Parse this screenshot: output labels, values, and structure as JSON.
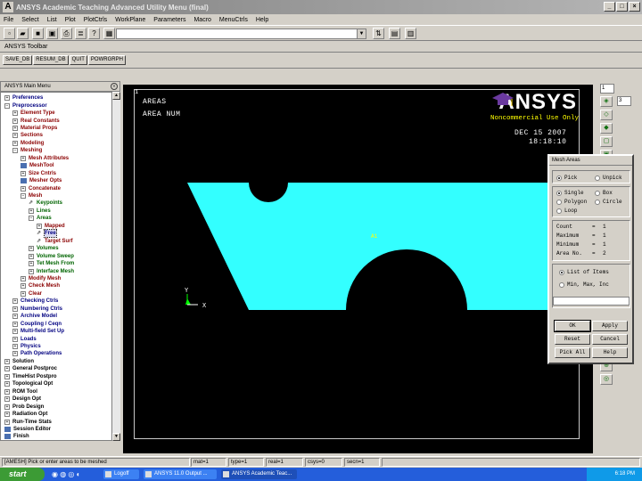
{
  "window": {
    "title": "ANSYS Academic Teaching Advanced Utility Menu (final)",
    "controls": [
      "_",
      "□",
      "×"
    ]
  },
  "menubar": [
    "File",
    "Select",
    "List",
    "Plot",
    "PlotCtrls",
    "WorkPlane",
    "Parameters",
    "Macro",
    "MenuCtrls",
    "Help"
  ],
  "toolbar": {
    "title": "ANSYS Toolbar",
    "buttons": [
      "SAVE_DB",
      "RESUM_DB",
      "QUIT",
      "POWRGRPH"
    ],
    "command_value": ""
  },
  "main_menu": {
    "title": "ANSYS Main Menu",
    "items": [
      {
        "label": "Preferences",
        "level": 0,
        "kind": "box",
        "color": "#000080"
      },
      {
        "label": "Preprocessor",
        "level": 0,
        "kind": "minus",
        "color": "#000080"
      },
      {
        "label": "Element Type",
        "level": 1,
        "kind": "box",
        "color": "#8b0000"
      },
      {
        "label": "Real Constants",
        "level": 1,
        "kind": "box",
        "color": "#8b0000"
      },
      {
        "label": "Material Props",
        "level": 1,
        "kind": "box",
        "color": "#8b0000"
      },
      {
        "label": "Sections",
        "level": 1,
        "kind": "box",
        "color": "#8b0000"
      },
      {
        "label": "Modeling",
        "level": 1,
        "kind": "box",
        "color": "#8b0000"
      },
      {
        "label": "Meshing",
        "level": 1,
        "kind": "minus",
        "color": "#8b0000"
      },
      {
        "label": "Mesh Attributes",
        "level": 2,
        "kind": "box",
        "color": "#8b0000"
      },
      {
        "label": "MeshTool",
        "level": 2,
        "kind": "icon",
        "color": "#8b0000"
      },
      {
        "label": "Size Cntrls",
        "level": 2,
        "kind": "box",
        "color": "#8b0000"
      },
      {
        "label": "Mesher Opts",
        "level": 2,
        "kind": "icon",
        "color": "#8b0000"
      },
      {
        "label": "Concatenate",
        "level": 2,
        "kind": "box",
        "color": "#8b0000"
      },
      {
        "label": "Mesh",
        "level": 2,
        "kind": "minus",
        "color": "#8b0000"
      },
      {
        "label": "Keypoints",
        "level": 3,
        "kind": "pin",
        "color": "#006400"
      },
      {
        "label": "Lines",
        "level": 3,
        "kind": "box",
        "color": "#006400"
      },
      {
        "label": "Areas",
        "level": 3,
        "kind": "minus",
        "color": "#006400"
      },
      {
        "label": "Mapped",
        "level": 4,
        "kind": "box",
        "color": "#8b0000"
      },
      {
        "label": "Free",
        "level": 4,
        "kind": "pin",
        "color": "#000080",
        "selected": true
      },
      {
        "label": "Target Surf",
        "level": 4,
        "kind": "pin",
        "color": "#8b0000"
      },
      {
        "label": "Volumes",
        "level": 3,
        "kind": "box",
        "color": "#006400"
      },
      {
        "label": "Volume Sweep",
        "level": 3,
        "kind": "box",
        "color": "#006400"
      },
      {
        "label": "Tet Mesh From",
        "level": 3,
        "kind": "box",
        "color": "#006400"
      },
      {
        "label": "Interface Mesh",
        "level": 3,
        "kind": "box",
        "color": "#006400"
      },
      {
        "label": "Modify Mesh",
        "level": 2,
        "kind": "box",
        "color": "#8b0000"
      },
      {
        "label": "Check Mesh",
        "level": 2,
        "kind": "box",
        "color": "#8b0000"
      },
      {
        "label": "Clear",
        "level": 2,
        "kind": "box",
        "color": "#8b0000"
      },
      {
        "label": "Checking Ctrls",
        "level": 1,
        "kind": "box",
        "color": "#000080"
      },
      {
        "label": "Numbering Ctrls",
        "level": 1,
        "kind": "box",
        "color": "#000080"
      },
      {
        "label": "Archive Model",
        "level": 1,
        "kind": "box",
        "color": "#000080"
      },
      {
        "label": "Coupling / Ceqn",
        "level": 1,
        "kind": "box",
        "color": "#000080"
      },
      {
        "label": "Multi-field Set Up",
        "level": 1,
        "kind": "box",
        "color": "#000080"
      },
      {
        "label": "Loads",
        "level": 1,
        "kind": "box",
        "color": "#000080"
      },
      {
        "label": "Physics",
        "level": 1,
        "kind": "box",
        "color": "#000080"
      },
      {
        "label": "Path Operations",
        "level": 1,
        "kind": "box",
        "color": "#000080"
      },
      {
        "label": "Solution",
        "level": 0,
        "kind": "box",
        "color": "#000"
      },
      {
        "label": "General Postproc",
        "level": 0,
        "kind": "box",
        "color": "#000"
      },
      {
        "label": "TimeHist Postpro",
        "level": 0,
        "kind": "box",
        "color": "#000"
      },
      {
        "label": "Topological Opt",
        "level": 0,
        "kind": "box",
        "color": "#000"
      },
      {
        "label": "ROM Tool",
        "level": 0,
        "kind": "box",
        "color": "#000"
      },
      {
        "label": "Design Opt",
        "level": 0,
        "kind": "box",
        "color": "#000"
      },
      {
        "label": "Prob Design",
        "level": 0,
        "kind": "box",
        "color": "#000"
      },
      {
        "label": "Radiation Opt",
        "level": 0,
        "kind": "box",
        "color": "#000"
      },
      {
        "label": "Run-Time Stats",
        "level": 0,
        "kind": "box",
        "color": "#000"
      },
      {
        "label": "Session Editor",
        "level": 0,
        "kind": "icon",
        "color": "#000"
      },
      {
        "label": "Finish",
        "level": 0,
        "kind": "icon",
        "color": "#000"
      }
    ]
  },
  "graphics": {
    "window_number": "1",
    "header_lines": [
      "AREAS",
      "AREA NUM"
    ],
    "date": "DEC 15 2007",
    "time": "18:18:10",
    "logo_text": "ANSYS",
    "license_note": "Noncommercial Use Only",
    "area_label": "A1",
    "axis_y": "Y",
    "axis_x": "X",
    "shape_color": "#33ffff",
    "background": "#000000"
  },
  "right_toolbar": {
    "window_select": "1",
    "view_select": "3"
  },
  "dialog": {
    "title": "Mesh Areas",
    "pick": "Pick",
    "unpick": "Unpick",
    "single": "Single",
    "box": "Box",
    "polygon": "Polygon",
    "circle": "Circle",
    "loop": "Loop",
    "stats": [
      {
        "k": "Count",
        "v": "1"
      },
      {
        "k": "Maximum",
        "v": "1"
      },
      {
        "k": "Minimum",
        "v": "1"
      },
      {
        "k": "Area No.",
        "v": "2"
      }
    ],
    "list_of_items": "List of Items",
    "min_max_inc": "Min, Max, Inc",
    "input_value": "",
    "buttons": {
      "ok": "OK",
      "apply": "Apply",
      "reset": "Reset",
      "cancel": "Cancel",
      "pick_all": "Pick All",
      "help": "Help"
    }
  },
  "status": {
    "prompt": "[AMESH]  Pick or enter areas to be meshed",
    "mat": "mat=1",
    "type": "type=1",
    "real": "real=1",
    "csys": "csys=0",
    "secn": "secn=1"
  },
  "taskbar": {
    "start": "start",
    "tasks": [
      "Logoff",
      "ANSYS 11.0 Output ...",
      "ANSYS Academic Teac..."
    ],
    "clock": "6:18 PM"
  }
}
